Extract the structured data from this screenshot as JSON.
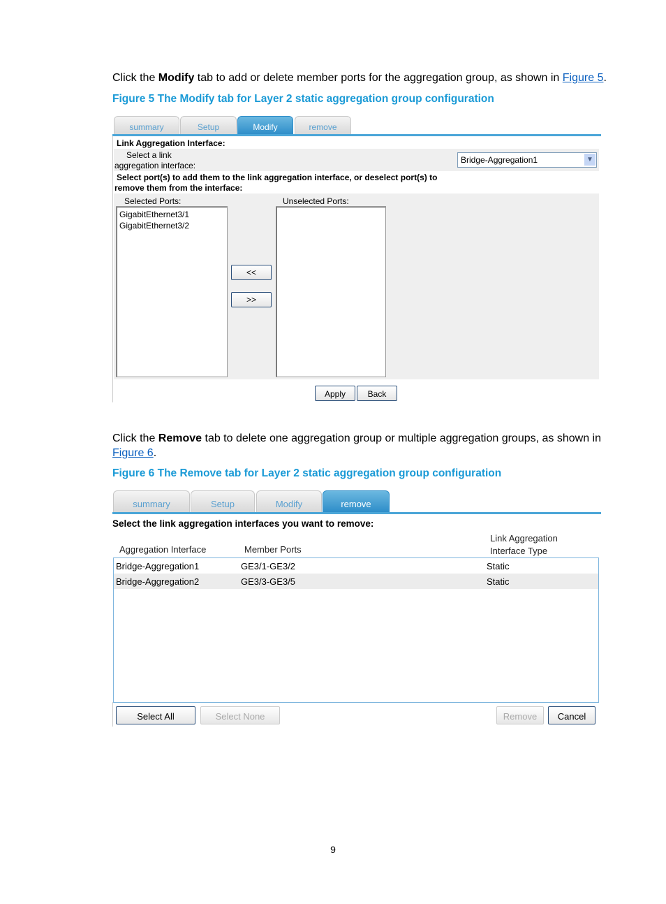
{
  "para1": {
    "pre": "Click the ",
    "bold": "Modify",
    "post": " tab to add or delete member ports for the aggregation group, as shown in ",
    "link": "Figure 5",
    "end": "."
  },
  "fig5": {
    "caption_pre": "Figure 5 The ",
    "caption_bold": "Modify",
    "caption_post": " tab for Layer 2 static aggregation group configuration",
    "tabs": [
      "summary",
      "Setup",
      "Modify",
      "remove"
    ],
    "active_tab": "Modify",
    "section1": "Link Aggregation Interface:",
    "select_label_1": "Select a link",
    "select_label_2": "aggregation interface:",
    "select_value": "Bridge-Aggregation1",
    "section2_1": "Select port(s) to add them to the link aggregation interface, or deselect port(s) to",
    "section2_2": "remove them from the interface:",
    "selected_label": "Selected Ports:",
    "unselected_label": "Unselected Ports:",
    "selected_ports": [
      "GigabitEthernet3/1",
      "GigabitEthernet3/2"
    ],
    "add_btn": "<<",
    "remove_btn": ">>",
    "apply": "Apply",
    "back": "Back"
  },
  "para2": {
    "pre": "Click the ",
    "bold": "Remove",
    "post": " tab to delete one aggregation group or multiple aggregation groups, as shown in",
    "link": "Figure 6",
    "end": "."
  },
  "fig6": {
    "caption_pre": "Figure 6 The ",
    "caption_bold": "Remove",
    "caption_post": " tab for Layer 2 static aggregation group configuration",
    "tabs": [
      "summary",
      "Setup",
      "Modify",
      "remove"
    ],
    "active_tab": "remove",
    "heading": "Select the link aggregation interfaces you want to remove:",
    "columns": [
      "Aggregation Interface",
      "Member Ports",
      "Link Aggregation",
      "Interface Type"
    ],
    "rows": [
      [
        "Bridge-Aggregation1",
        "GE3/1-GE3/2",
        "Static"
      ],
      [
        "Bridge-Aggregation2",
        "GE3/3-GE3/5",
        "Static"
      ]
    ],
    "select_all": "Select All",
    "select_none": "Select None",
    "remove": "Remove",
    "cancel": "Cancel"
  },
  "page_number": "9"
}
